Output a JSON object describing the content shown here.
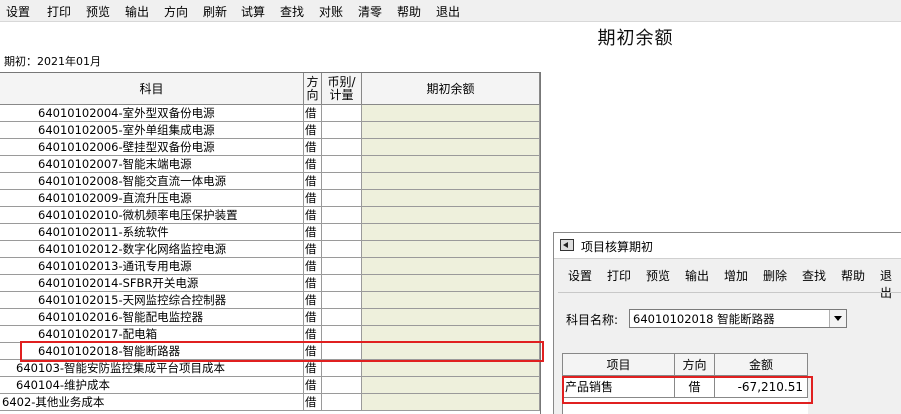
{
  "menu": [
    "设置",
    "打印",
    "预览",
    "输出",
    "方向",
    "刷新",
    "试算",
    "查找",
    "对账",
    "清零",
    "帮助",
    "退出"
  ],
  "title": "期初余额",
  "period": "期初：2021年01月",
  "grid": {
    "headers": {
      "subject": "科目",
      "direction_1": "方",
      "direction_2": "向",
      "currency_1": "币别/",
      "currency_2": "计量",
      "balance": "期初余额"
    },
    "rows": [
      {
        "subject": "64010102004-室外型双备份电源",
        "dir": "借",
        "level": 3
      },
      {
        "subject": "64010102005-室外单组集成电源",
        "dir": "借",
        "level": 3
      },
      {
        "subject": "64010102006-壁挂型双备份电源",
        "dir": "借",
        "level": 3
      },
      {
        "subject": "64010102007-智能末端电源",
        "dir": "借",
        "level": 3
      },
      {
        "subject": "64010102008-智能交直流一体电源",
        "dir": "借",
        "level": 3
      },
      {
        "subject": "64010102009-直流升压电源",
        "dir": "借",
        "level": 3
      },
      {
        "subject": "64010102010-微机频率电压保护装置",
        "dir": "借",
        "level": 3
      },
      {
        "subject": "64010102011-系统软件",
        "dir": "借",
        "level": 3
      },
      {
        "subject": "64010102012-数字化网络监控电源",
        "dir": "借",
        "level": 3
      },
      {
        "subject": "64010102013-通讯专用电源",
        "dir": "借",
        "level": 3
      },
      {
        "subject": "64010102014-SFBR开关电源",
        "dir": "借",
        "level": 3
      },
      {
        "subject": "64010102015-天网监控综合控制器",
        "dir": "借",
        "level": 3
      },
      {
        "subject": "64010102016-智能配电监控器",
        "dir": "借",
        "level": 3
      },
      {
        "subject": "64010102017-配电箱",
        "dir": "借",
        "level": 3
      },
      {
        "subject": "64010102018-智能断路器",
        "dir": "借",
        "level": 3
      },
      {
        "subject": "640103-智能安防监控集成平台项目成本",
        "dir": "借",
        "level": 2
      },
      {
        "subject": "640104-维护成本",
        "dir": "借",
        "level": 2
      },
      {
        "subject": "6402-其他业务成本",
        "dir": "借",
        "level": 1
      }
    ]
  },
  "dialog": {
    "title": "项目核算期初",
    "toolbar": [
      "设置",
      "打印",
      "预览",
      "输出",
      "增加",
      "删除",
      "查找",
      "帮助",
      "退出"
    ],
    "subject_label": "科目名称:",
    "subject_value": "64010102018 智能断路器",
    "table": {
      "headers": {
        "item": "项目",
        "direction": "方向",
        "amount": "金额"
      },
      "rows": [
        {
          "item": "产品销售",
          "direction": "借",
          "amount": "-67,210.51"
        }
      ]
    }
  },
  "colors": {
    "highlight": "#e02020",
    "balance_cell": "#eef0dc"
  }
}
